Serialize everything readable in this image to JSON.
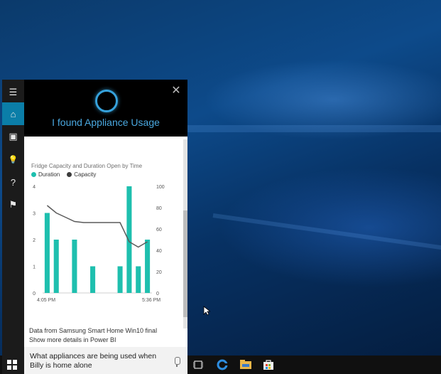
{
  "cortana": {
    "header_title": "I found Appliance Usage",
    "close_symbol": "✕"
  },
  "rail": {
    "items": [
      {
        "name": "menu",
        "glyph": "☰"
      },
      {
        "name": "home",
        "glyph": "⌂"
      },
      {
        "name": "notebook",
        "glyph": "▣"
      },
      {
        "name": "tips",
        "glyph": "💡"
      },
      {
        "name": "help",
        "glyph": "?"
      },
      {
        "name": "feedback",
        "glyph": "⚑"
      }
    ]
  },
  "card": {
    "chart_title": "Fridge Capacity and Duration Open by Time",
    "legend": [
      {
        "label": "Duration",
        "color": "#1ebfae"
      },
      {
        "label": "Capacity",
        "color": "#3c3c3c"
      }
    ],
    "source_text": "Data from Samsung Smart Home Win10 final",
    "link_text": "Show more details in Power BI"
  },
  "chart_data": {
    "type": "bar",
    "title": "Fridge Capacity and Duration Open by Time",
    "x_tick_labels": [
      "4:05 PM",
      "5:36 PM"
    ],
    "y_left_ticks": [
      0,
      1,
      2,
      3,
      4
    ],
    "y_right_ticks": [
      0,
      20,
      40,
      60,
      80,
      100
    ],
    "ylim_left": [
      0,
      4
    ],
    "ylim_right": [
      0,
      100
    ],
    "series": [
      {
        "name": "Duration",
        "type": "bar",
        "color": "#1ebfae",
        "values": [
          3,
          2,
          0,
          2,
          0,
          1,
          0,
          0,
          1,
          4,
          1,
          2
        ]
      },
      {
        "name": "Capacity",
        "type": "line",
        "color": "#5a5a5a",
        "values": [
          82,
          75,
          71,
          67,
          66,
          66,
          66,
          66,
          66,
          48,
          43,
          48
        ]
      }
    ]
  },
  "query": {
    "text": "What appliances are being used when Billy is home alone"
  },
  "taskbar": {
    "icons": [
      "task-view-icon",
      "edge-icon",
      "file-explorer-icon",
      "store-icon"
    ]
  }
}
